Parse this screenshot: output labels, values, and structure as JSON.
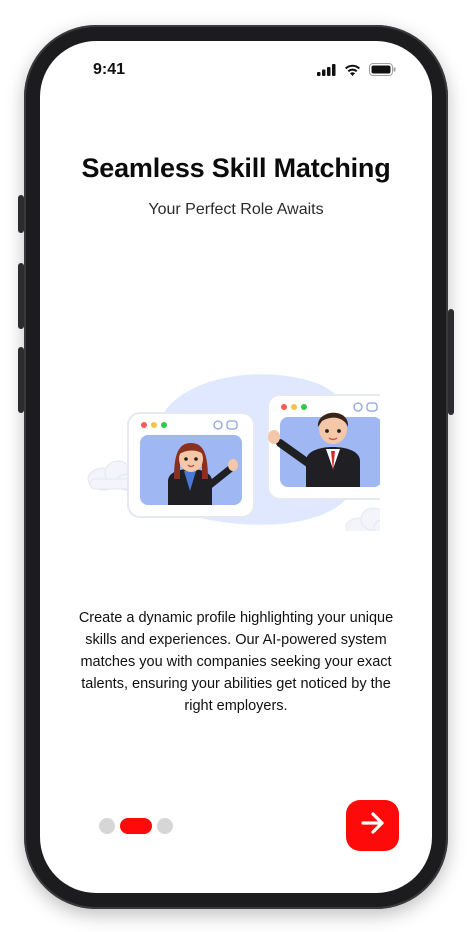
{
  "status_bar": {
    "time": "9:41",
    "icons": [
      "cellular-signal-icon",
      "wifi-icon",
      "battery-icon"
    ]
  },
  "onboarding": {
    "title": "Seamless Skill Matching",
    "subtitle": "Your Perfect Role Awaits",
    "illustration": "video-call-illustration",
    "description": "Create a dynamic profile highlighting your unique skills and experiences. Our AI-powered system matches you with companies seeking your exact talents, ensuring your abilities get noticed by the right employers.",
    "pagination": {
      "total": 3,
      "current": 2
    },
    "next_button_icon": "arrow-right-icon"
  },
  "colors": {
    "accent": "#ff0a0a",
    "inactive_dot": "#d6d6d6",
    "illustration_blob": "#dfe8ff"
  }
}
